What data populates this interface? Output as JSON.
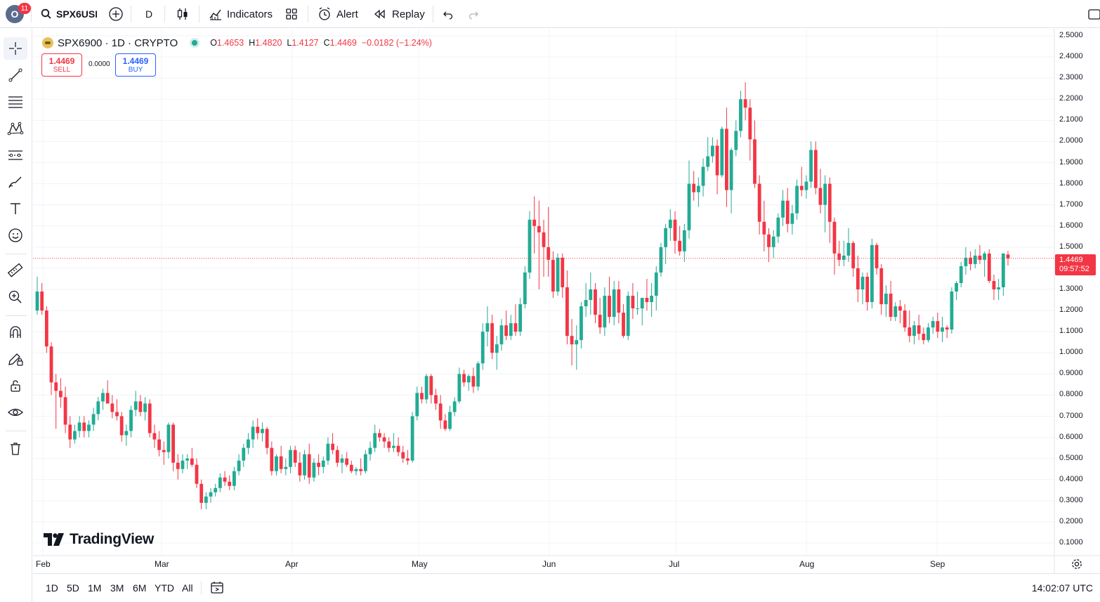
{
  "topbar": {
    "avatar_letter": "O",
    "notification_count": "11",
    "symbol": "SPX6USD",
    "interval": "D",
    "indicators_label": "Indicators",
    "alert_label": "Alert",
    "replay_label": "Replay"
  },
  "legend": {
    "title": "SPX6900 · 1D · CRYPTO",
    "open_label": "O",
    "open": "1.4653",
    "high_label": "H",
    "high": "1.4820",
    "low_label": "L",
    "low": "1.4127",
    "close_label": "C",
    "close": "1.4469",
    "change": "−0.0182 (−1.24%)"
  },
  "trade": {
    "sell_price": "1.4469",
    "sell_label": "SELL",
    "spread": "0.0000",
    "buy_price": "1.4469",
    "buy_label": "BUY"
  },
  "price_axis": {
    "ticks": [
      "2.5000",
      "2.4000",
      "2.3000",
      "2.2000",
      "2.1000",
      "2.0000",
      "1.9000",
      "1.8000",
      "1.7000",
      "1.6000",
      "1.5000",
      "1.4000",
      "1.3000",
      "1.2000",
      "1.1000",
      "1.0000",
      "0.9000",
      "0.8000",
      "0.7000",
      "0.6000",
      "0.5000",
      "0.4000",
      "0.3000",
      "0.2000",
      "0.1000"
    ],
    "current_price": "1.4469",
    "countdown": "09:57:52"
  },
  "time_axis": {
    "labels": [
      "Feb",
      "Mar",
      "Apr",
      "May",
      "Jun",
      "Jul",
      "Aug",
      "Sep"
    ]
  },
  "watermark": "TradingView",
  "bottombar": {
    "ranges": [
      "1D",
      "5D",
      "1M",
      "3M",
      "6M",
      "YTD",
      "All"
    ],
    "clock": "14:02:07 UTC"
  },
  "colors": {
    "up": "#22ab94",
    "down": "#f23645",
    "accent": "#2962ff"
  },
  "chart_data": {
    "type": "candlestick",
    "symbol": "SPX6900",
    "interval": "1D",
    "ylim": [
      0.05,
      2.55
    ],
    "x_labels": [
      "Feb",
      "Mar",
      "Apr",
      "May",
      "Jun",
      "Jul",
      "Aug",
      "Sep"
    ],
    "ohlc": [
      [
        1.2,
        1.36,
        1.18,
        1.29
      ],
      [
        1.29,
        1.33,
        1.18,
        1.2
      ],
      [
        1.2,
        1.22,
        1.0,
        1.03
      ],
      [
        1.03,
        1.05,
        0.8,
        0.86
      ],
      [
        0.86,
        0.9,
        0.64,
        0.82
      ],
      [
        0.82,
        0.88,
        0.74,
        0.79
      ],
      [
        0.79,
        0.84,
        0.62,
        0.66
      ],
      [
        0.66,
        0.7,
        0.55,
        0.59
      ],
      [
        0.59,
        0.66,
        0.57,
        0.63
      ],
      [
        0.63,
        0.7,
        0.6,
        0.67
      ],
      [
        0.67,
        0.7,
        0.6,
        0.63
      ],
      [
        0.63,
        0.68,
        0.6,
        0.66
      ],
      [
        0.66,
        0.74,
        0.63,
        0.71
      ],
      [
        0.71,
        0.79,
        0.68,
        0.77
      ],
      [
        0.77,
        0.83,
        0.73,
        0.81
      ],
      [
        0.81,
        0.87,
        0.78,
        0.76
      ],
      [
        0.76,
        0.8,
        0.69,
        0.72
      ],
      [
        0.72,
        0.78,
        0.68,
        0.7
      ],
      [
        0.7,
        0.72,
        0.58,
        0.61
      ],
      [
        0.61,
        0.66,
        0.56,
        0.63
      ],
      [
        0.63,
        0.75,
        0.6,
        0.73
      ],
      [
        0.73,
        0.82,
        0.7,
        0.77
      ],
      [
        0.77,
        0.8,
        0.7,
        0.72
      ],
      [
        0.72,
        0.79,
        0.68,
        0.76
      ],
      [
        0.76,
        0.78,
        0.6,
        0.62
      ],
      [
        0.62,
        0.66,
        0.55,
        0.59
      ],
      [
        0.59,
        0.63,
        0.51,
        0.54
      ],
      [
        0.54,
        0.58,
        0.47,
        0.53
      ],
      [
        0.53,
        0.67,
        0.5,
        0.66
      ],
      [
        0.66,
        0.67,
        0.44,
        0.48
      ],
      [
        0.48,
        0.52,
        0.4,
        0.45
      ],
      [
        0.45,
        0.52,
        0.43,
        0.49
      ],
      [
        0.49,
        0.52,
        0.45,
        0.5
      ],
      [
        0.5,
        0.55,
        0.46,
        0.47
      ],
      [
        0.47,
        0.5,
        0.36,
        0.38
      ],
      [
        0.38,
        0.4,
        0.26,
        0.29
      ],
      [
        0.29,
        0.34,
        0.26,
        0.32
      ],
      [
        0.32,
        0.36,
        0.29,
        0.34
      ],
      [
        0.34,
        0.38,
        0.32,
        0.36
      ],
      [
        0.36,
        0.43,
        0.34,
        0.41
      ],
      [
        0.41,
        0.44,
        0.37,
        0.39
      ],
      [
        0.39,
        0.42,
        0.35,
        0.37
      ],
      [
        0.37,
        0.46,
        0.35,
        0.44
      ],
      [
        0.44,
        0.52,
        0.42,
        0.49
      ],
      [
        0.49,
        0.57,
        0.46,
        0.55
      ],
      [
        0.55,
        0.62,
        0.52,
        0.59
      ],
      [
        0.59,
        0.68,
        0.55,
        0.65
      ],
      [
        0.65,
        0.69,
        0.59,
        0.62
      ],
      [
        0.62,
        0.67,
        0.58,
        0.64
      ],
      [
        0.64,
        0.65,
        0.52,
        0.55
      ],
      [
        0.55,
        0.58,
        0.42,
        0.44
      ],
      [
        0.44,
        0.52,
        0.42,
        0.51
      ],
      [
        0.51,
        0.56,
        0.43,
        0.45
      ],
      [
        0.45,
        0.5,
        0.42,
        0.46
      ],
      [
        0.46,
        0.56,
        0.43,
        0.54
      ],
      [
        0.54,
        0.56,
        0.46,
        0.48
      ],
      [
        0.48,
        0.53,
        0.39,
        0.42
      ],
      [
        0.42,
        0.54,
        0.4,
        0.52
      ],
      [
        0.52,
        0.57,
        0.38,
        0.41
      ],
      [
        0.41,
        0.5,
        0.39,
        0.48
      ],
      [
        0.48,
        0.52,
        0.42,
        0.46
      ],
      [
        0.46,
        0.51,
        0.43,
        0.49
      ],
      [
        0.49,
        0.6,
        0.47,
        0.57
      ],
      [
        0.57,
        0.62,
        0.52,
        0.54
      ],
      [
        0.54,
        0.56,
        0.46,
        0.48
      ],
      [
        0.48,
        0.52,
        0.43,
        0.5
      ],
      [
        0.5,
        0.53,
        0.46,
        0.47
      ],
      [
        0.47,
        0.49,
        0.43,
        0.44
      ],
      [
        0.44,
        0.46,
        0.42,
        0.45
      ],
      [
        0.45,
        0.5,
        0.42,
        0.44
      ],
      [
        0.44,
        0.54,
        0.43,
        0.52
      ],
      [
        0.52,
        0.58,
        0.49,
        0.55
      ],
      [
        0.55,
        0.66,
        0.53,
        0.62
      ],
      [
        0.62,
        0.64,
        0.58,
        0.6
      ],
      [
        0.6,
        0.62,
        0.55,
        0.58
      ],
      [
        0.58,
        0.6,
        0.53,
        0.55
      ],
      [
        0.55,
        0.62,
        0.53,
        0.56
      ],
      [
        0.56,
        0.6,
        0.51,
        0.53
      ],
      [
        0.53,
        0.56,
        0.48,
        0.5
      ],
      [
        0.5,
        0.54,
        0.47,
        0.49
      ],
      [
        0.49,
        0.72,
        0.48,
        0.7
      ],
      [
        0.7,
        0.84,
        0.68,
        0.81
      ],
      [
        0.81,
        0.84,
        0.76,
        0.78
      ],
      [
        0.78,
        0.9,
        0.76,
        0.89
      ],
      [
        0.89,
        0.9,
        0.76,
        0.8
      ],
      [
        0.8,
        0.83,
        0.73,
        0.76
      ],
      [
        0.76,
        0.8,
        0.64,
        0.68
      ],
      [
        0.68,
        0.71,
        0.63,
        0.64
      ],
      [
        0.64,
        0.75,
        0.63,
        0.72
      ],
      [
        0.72,
        0.79,
        0.7,
        0.77
      ],
      [
        0.77,
        0.93,
        0.76,
        0.9
      ],
      [
        0.9,
        0.92,
        0.84,
        0.86
      ],
      [
        0.86,
        0.9,
        0.82,
        0.89
      ],
      [
        0.89,
        0.93,
        0.81,
        0.84
      ],
      [
        0.84,
        0.96,
        0.82,
        0.95
      ],
      [
        0.95,
        1.14,
        0.92,
        1.1
      ],
      [
        1.1,
        1.22,
        1.03,
        1.14
      ],
      [
        1.14,
        1.18,
        0.97,
        1.0
      ],
      [
        1.0,
        1.08,
        0.92,
        1.04
      ],
      [
        1.04,
        1.16,
        1.01,
        1.13
      ],
      [
        1.13,
        1.2,
        1.06,
        1.08
      ],
      [
        1.08,
        1.18,
        1.06,
        1.14
      ],
      [
        1.14,
        1.23,
        1.08,
        1.1
      ],
      [
        1.1,
        1.26,
        1.08,
        1.23
      ],
      [
        1.23,
        1.41,
        1.21,
        1.38
      ],
      [
        1.38,
        1.67,
        1.35,
        1.63
      ],
      [
        1.63,
        1.74,
        1.47,
        1.6
      ],
      [
        1.6,
        1.72,
        1.3,
        1.57
      ],
      [
        1.57,
        1.63,
        1.36,
        1.5
      ],
      [
        1.5,
        1.69,
        1.36,
        1.44
      ],
      [
        1.44,
        1.48,
        1.26,
        1.29
      ],
      [
        1.29,
        1.47,
        1.27,
        1.45
      ],
      [
        1.45,
        1.47,
        1.26,
        1.31
      ],
      [
        1.31,
        1.39,
        1.04,
        1.08
      ],
      [
        1.08,
        1.16,
        0.94,
        1.04
      ],
      [
        1.04,
        1.13,
        0.92,
        1.06
      ],
      [
        1.06,
        1.24,
        1.02,
        1.22
      ],
      [
        1.22,
        1.33,
        1.17,
        1.25
      ],
      [
        1.25,
        1.38,
        1.18,
        1.3
      ],
      [
        1.3,
        1.33,
        1.14,
        1.18
      ],
      [
        1.18,
        1.26,
        1.09,
        1.12
      ],
      [
        1.12,
        1.31,
        1.08,
        1.27
      ],
      [
        1.27,
        1.36,
        1.14,
        1.17
      ],
      [
        1.17,
        1.34,
        1.13,
        1.3
      ],
      [
        1.3,
        1.34,
        1.14,
        1.19
      ],
      [
        1.19,
        1.23,
        1.07,
        1.08
      ],
      [
        1.08,
        1.29,
        1.06,
        1.27
      ],
      [
        1.27,
        1.33,
        1.16,
        1.21
      ],
      [
        1.21,
        1.29,
        1.18,
        1.21
      ],
      [
        1.21,
        1.25,
        1.13,
        1.26
      ],
      [
        1.26,
        1.35,
        1.2,
        1.24
      ],
      [
        1.24,
        1.33,
        1.17,
        1.27
      ],
      [
        1.27,
        1.41,
        1.2,
        1.38
      ],
      [
        1.38,
        1.52,
        1.36,
        1.5
      ],
      [
        1.5,
        1.61,
        1.42,
        1.59
      ],
      [
        1.59,
        1.68,
        1.53,
        1.63
      ],
      [
        1.63,
        1.67,
        1.47,
        1.53
      ],
      [
        1.53,
        1.6,
        1.46,
        1.48
      ],
      [
        1.48,
        1.61,
        1.43,
        1.58
      ],
      [
        1.58,
        1.91,
        1.54,
        1.8
      ],
      [
        1.8,
        1.86,
        1.72,
        1.76
      ],
      [
        1.76,
        1.83,
        1.69,
        1.79
      ],
      [
        1.79,
        1.92,
        1.74,
        1.88
      ],
      [
        1.88,
        2.02,
        1.86,
        1.93
      ],
      [
        1.93,
        2.02,
        1.9,
        1.98
      ],
      [
        1.98,
        2.01,
        1.75,
        1.84
      ],
      [
        1.84,
        2.07,
        1.83,
        2.06
      ],
      [
        2.06,
        2.16,
        1.69,
        1.77
      ],
      [
        1.77,
        1.97,
        1.66,
        1.96
      ],
      [
        1.96,
        2.1,
        1.93,
        2.05
      ],
      [
        2.05,
        2.24,
        2.02,
        2.2
      ],
      [
        2.2,
        2.28,
        2.1,
        2.16
      ],
      [
        2.16,
        2.2,
        1.91,
        2.01
      ],
      [
        2.01,
        2.1,
        1.78,
        1.8
      ],
      [
        1.8,
        1.84,
        1.56,
        1.62
      ],
      [
        1.62,
        1.72,
        1.48,
        1.56
      ],
      [
        1.56,
        1.59,
        1.43,
        1.5
      ],
      [
        1.5,
        1.58,
        1.45,
        1.55
      ],
      [
        1.55,
        1.66,
        1.52,
        1.64
      ],
      [
        1.64,
        1.77,
        1.6,
        1.72
      ],
      [
        1.72,
        1.78,
        1.57,
        1.61
      ],
      [
        1.61,
        1.7,
        1.56,
        1.66
      ],
      [
        1.66,
        1.82,
        1.63,
        1.79
      ],
      [
        1.79,
        1.88,
        1.74,
        1.77
      ],
      [
        1.77,
        1.84,
        1.73,
        1.81
      ],
      [
        1.81,
        2.0,
        1.78,
        1.96
      ],
      [
        1.96,
        2.0,
        1.75,
        1.78
      ],
      [
        1.78,
        1.87,
        1.66,
        1.7
      ],
      [
        1.7,
        1.84,
        1.57,
        1.8
      ],
      [
        1.8,
        1.83,
        1.52,
        1.62
      ],
      [
        1.62,
        1.64,
        1.37,
        1.47
      ],
      [
        1.47,
        1.53,
        1.41,
        1.44
      ],
      [
        1.44,
        1.53,
        1.41,
        1.46
      ],
      [
        1.46,
        1.59,
        1.43,
        1.52
      ],
      [
        1.52,
        1.53,
        1.36,
        1.4
      ],
      [
        1.4,
        1.46,
        1.24,
        1.3
      ],
      [
        1.3,
        1.38,
        1.23,
        1.36
      ],
      [
        1.36,
        1.38,
        1.2,
        1.24
      ],
      [
        1.24,
        1.54,
        1.21,
        1.51
      ],
      [
        1.51,
        1.52,
        1.37,
        1.4
      ],
      [
        1.4,
        1.42,
        1.18,
        1.23
      ],
      [
        1.23,
        1.32,
        1.17,
        1.28
      ],
      [
        1.28,
        1.34,
        1.15,
        1.17
      ],
      [
        1.17,
        1.24,
        1.15,
        1.22
      ],
      [
        1.22,
        1.25,
        1.14,
        1.2
      ],
      [
        1.2,
        1.23,
        1.1,
        1.12
      ],
      [
        1.12,
        1.2,
        1.05,
        1.08
      ],
      [
        1.08,
        1.15,
        1.04,
        1.13
      ],
      [
        1.13,
        1.18,
        1.06,
        1.09
      ],
      [
        1.09,
        1.12,
        1.04,
        1.06
      ],
      [
        1.06,
        1.14,
        1.05,
        1.12
      ],
      [
        1.12,
        1.17,
        1.09,
        1.15
      ],
      [
        1.15,
        1.19,
        1.07,
        1.1
      ],
      [
        1.1,
        1.17,
        1.05,
        1.12
      ],
      [
        1.12,
        1.13,
        1.07,
        1.11
      ],
      [
        1.11,
        1.31,
        1.09,
        1.29
      ],
      [
        1.29,
        1.34,
        1.25,
        1.33
      ],
      [
        1.33,
        1.43,
        1.31,
        1.41
      ],
      [
        1.41,
        1.5,
        1.37,
        1.45
      ],
      [
        1.45,
        1.48,
        1.39,
        1.42
      ],
      [
        1.42,
        1.49,
        1.4,
        1.46
      ],
      [
        1.46,
        1.51,
        1.42,
        1.44
      ],
      [
        1.44,
        1.48,
        1.36,
        1.47
      ],
      [
        1.47,
        1.49,
        1.33,
        1.34
      ],
      [
        1.34,
        1.37,
        1.25,
        1.3
      ],
      [
        1.3,
        1.35,
        1.25,
        1.31
      ],
      [
        1.31,
        1.47,
        1.27,
        1.47
      ],
      [
        1.4653,
        1.482,
        1.4127,
        1.4469
      ]
    ]
  }
}
